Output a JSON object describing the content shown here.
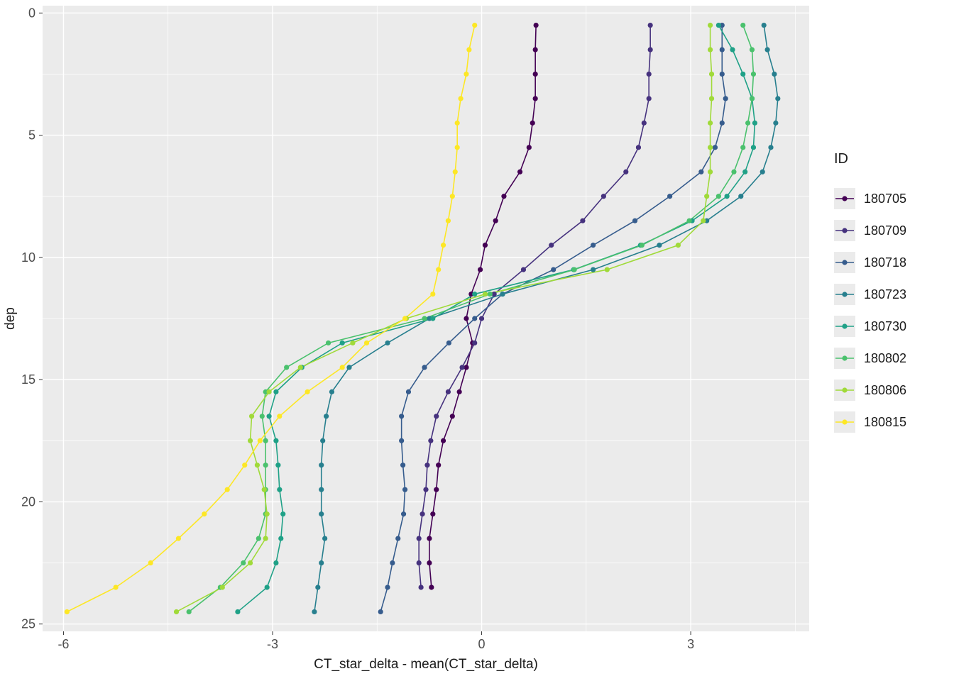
{
  "chart_data": {
    "type": "line",
    "xlabel": "CT_star_delta - mean(CT_star_delta)",
    "ylabel": "dep",
    "legend_title": "ID",
    "xlim": [
      -6.3,
      4.7
    ],
    "ylim": [
      25.3,
      -0.3
    ],
    "x_breaks": [
      -6,
      -3,
      0,
      3
    ],
    "y_breaks": [
      0,
      5,
      10,
      15,
      20,
      25
    ],
    "depths": [
      0.5,
      1.5,
      2.5,
      3.5,
      4.5,
      5.5,
      6.5,
      7.5,
      8.5,
      9.5,
      10.5,
      11.5,
      12.5,
      13.5,
      14.5,
      15.5,
      16.5,
      17.5,
      18.5,
      19.5,
      20.5,
      21.5,
      22.5,
      23.5,
      24.5
    ],
    "series": [
      {
        "name": "180705",
        "color": "#440154",
        "x": [
          0.78,
          0.77,
          0.77,
          0.77,
          0.73,
          0.68,
          0.55,
          0.32,
          0.2,
          0.05,
          -0.02,
          -0.15,
          -0.22,
          -0.13,
          -0.22,
          -0.32,
          -0.42,
          -0.55,
          -0.62,
          -0.65,
          -0.7,
          -0.75,
          -0.75,
          -0.72,
          null
        ]
      },
      {
        "name": "180709",
        "color": "#46327E",
        "x": [
          2.42,
          2.42,
          2.4,
          2.4,
          2.33,
          2.25,
          2.07,
          1.75,
          1.45,
          1.0,
          0.6,
          0.18,
          0.0,
          -0.1,
          -0.28,
          -0.48,
          -0.65,
          -0.73,
          -0.78,
          -0.8,
          -0.85,
          -0.9,
          -0.9,
          -0.87,
          null
        ]
      },
      {
        "name": "180718",
        "color": "#365C8D",
        "x": [
          3.45,
          3.45,
          3.45,
          3.5,
          3.45,
          3.35,
          3.15,
          2.7,
          2.2,
          1.6,
          1.03,
          0.3,
          -0.1,
          -0.47,
          -0.82,
          -1.05,
          -1.15,
          -1.15,
          -1.13,
          -1.1,
          -1.12,
          -1.2,
          -1.28,
          -1.35,
          -1.45
        ]
      },
      {
        "name": "180723",
        "color": "#277F8E",
        "x": [
          4.05,
          4.1,
          4.2,
          4.25,
          4.22,
          4.15,
          4.03,
          3.72,
          3.23,
          2.55,
          1.6,
          0.3,
          -0.75,
          -1.35,
          -1.9,
          -2.15,
          -2.23,
          -2.28,
          -2.3,
          -2.3,
          -2.3,
          -2.25,
          -2.3,
          -2.35,
          -2.4
        ]
      },
      {
        "name": "180730",
        "color": "#1FA187",
        "x": [
          3.4,
          3.6,
          3.75,
          3.88,
          3.92,
          3.9,
          3.78,
          3.52,
          3.02,
          2.28,
          1.32,
          -0.1,
          -0.7,
          -2.0,
          -2.58,
          -2.95,
          -3.05,
          -2.95,
          -2.92,
          -2.9,
          -2.85,
          -2.88,
          -2.95,
          -3.08,
          -3.5
        ]
      },
      {
        "name": "180802",
        "color": "#4AC16D",
        "x": [
          3.75,
          3.88,
          3.9,
          3.88,
          3.82,
          3.75,
          3.62,
          3.4,
          2.98,
          2.3,
          1.33,
          0.12,
          -0.82,
          -2.2,
          -2.8,
          -3.1,
          -3.15,
          -3.1,
          -3.1,
          -3.1,
          -3.1,
          -3.2,
          -3.42,
          -3.75,
          -4.2
        ]
      },
      {
        "name": "180806",
        "color": "#A0DA39",
        "x": [
          3.28,
          3.28,
          3.3,
          3.3,
          3.28,
          3.28,
          3.28,
          3.23,
          3.18,
          2.82,
          1.8,
          0.05,
          -1.08,
          -1.85,
          -2.6,
          -3.05,
          -3.3,
          -3.32,
          -3.22,
          -3.12,
          -3.08,
          -3.1,
          -3.32,
          -3.72,
          -4.38
        ]
      },
      {
        "name": "180815",
        "color": "#FDE725",
        "x": [
          -0.1,
          -0.18,
          -0.22,
          -0.3,
          -0.35,
          -0.35,
          -0.38,
          -0.42,
          -0.48,
          -0.55,
          -0.62,
          -0.7,
          -1.1,
          -1.65,
          -2.0,
          -2.5,
          -2.9,
          -3.18,
          -3.4,
          -3.65,
          -3.98,
          -4.35,
          -4.75,
          -5.25,
          -5.95
        ]
      }
    ]
  }
}
